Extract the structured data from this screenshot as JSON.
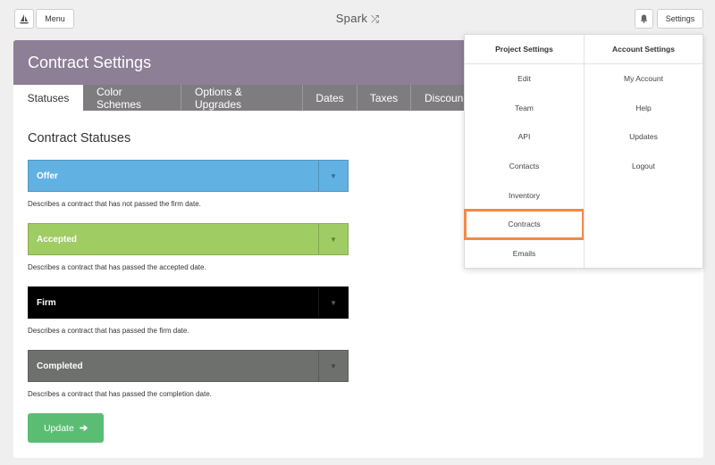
{
  "topbar": {
    "logo_icon": "sailboat-icon",
    "menu_label": "Menu",
    "brand": "Spark",
    "brand_icon": "shuffle-icon",
    "bell_icon": "bell-icon",
    "settings_label": "Settings"
  },
  "page": {
    "title": "Contract Settings",
    "tabs": [
      {
        "label": "Statuses"
      },
      {
        "label": "Color Schemes"
      },
      {
        "label": "Options & Upgrades"
      },
      {
        "label": "Dates"
      },
      {
        "label": "Taxes"
      },
      {
        "label": "Discoun"
      }
    ],
    "section_title": "Contract Statuses",
    "statuses": [
      {
        "label": "Offer",
        "color": "#62b1e3",
        "description": "Describes a contract that has not passed the firm date."
      },
      {
        "label": "Accepted",
        "color": "#a0cc64",
        "description": "Describes a contract that has passed the accepted date."
      },
      {
        "label": "Firm",
        "color": "#000000",
        "description": "Describes a contract that has passed the firm date."
      },
      {
        "label": "Completed",
        "color": "#6e706e",
        "description": "Describes a contract that has passed the completion date."
      }
    ],
    "update_label": "Update",
    "update_color": "#5bbd74"
  },
  "dropdown": {
    "project_header": "Project Settings",
    "account_header": "Account Settings",
    "project_items": [
      "Edit",
      "Team",
      "API",
      "Contacts",
      "Inventory",
      "Contracts",
      "Emails"
    ],
    "account_items": [
      "My Account",
      "Help",
      "Updates",
      "Logout"
    ],
    "highlight_color": "#f08a4b"
  }
}
